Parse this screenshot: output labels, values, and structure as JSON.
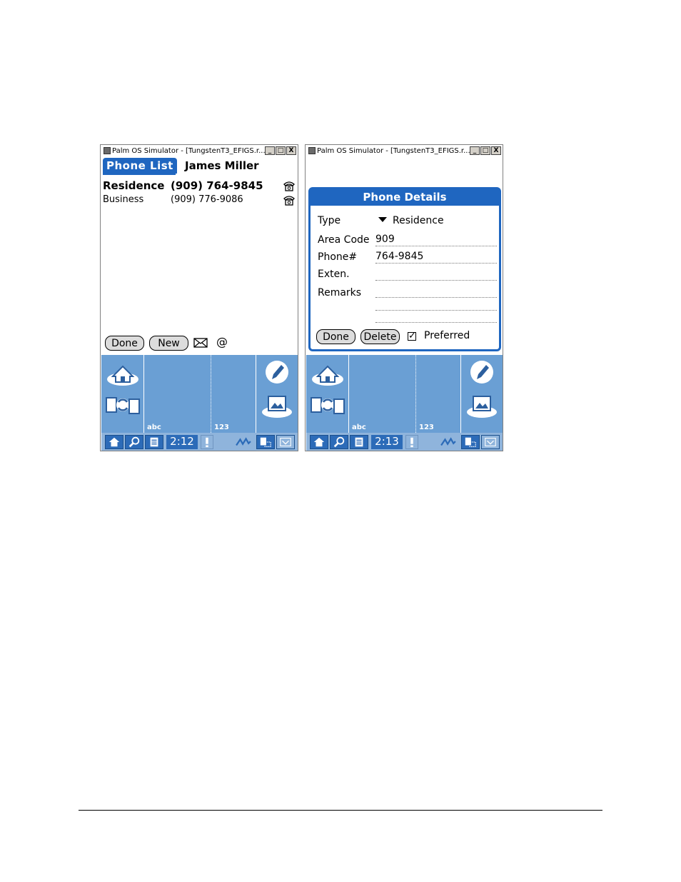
{
  "windows": [
    {
      "title": "Palm OS Simulator - [TungstenT3_EFIGS.r...",
      "controls": [
        "_",
        "□",
        "X"
      ],
      "screen": {
        "tab_label": "Phone List",
        "contact_name": "James Miller",
        "phones": [
          {
            "type": "Residence",
            "number": "(909) 764-9845"
          },
          {
            "type": "Business",
            "number": "(909) 776-9086"
          }
        ],
        "buttons": {
          "done": "Done",
          "new": "New"
        },
        "icons": [
          "mail-icon",
          "at-icon"
        ]
      },
      "graffiti": {
        "abc_label": "abc",
        "num_label": "123"
      },
      "status": {
        "time": "2:12"
      }
    },
    {
      "title": "Palm OS Simulator - [TungstenT3_EFIGS.r...",
      "controls": [
        "_",
        "□",
        "X"
      ],
      "dialog": {
        "title": "Phone Details",
        "fields": {
          "type_label": "Type",
          "type_value": "Residence",
          "area_code_label": "Area Code",
          "area_code_value": "909",
          "phone_label": "Phone#",
          "phone_value": "764-9845",
          "ext_label": "Exten.",
          "ext_value": "",
          "remarks_label": "Remarks",
          "remarks_value": ""
        },
        "buttons": {
          "done": "Done",
          "delete": "Delete"
        },
        "preferred_label": "Preferred",
        "preferred_checked": true,
        "check_mark": "✓"
      },
      "graffiti": {
        "abc_label": "abc",
        "num_label": "123"
      },
      "status": {
        "time": "2:13"
      }
    }
  ],
  "colors": {
    "accent": "#1f66c0",
    "graffiti": "#6a9fd4",
    "statusbar": "#8fb4dc"
  }
}
